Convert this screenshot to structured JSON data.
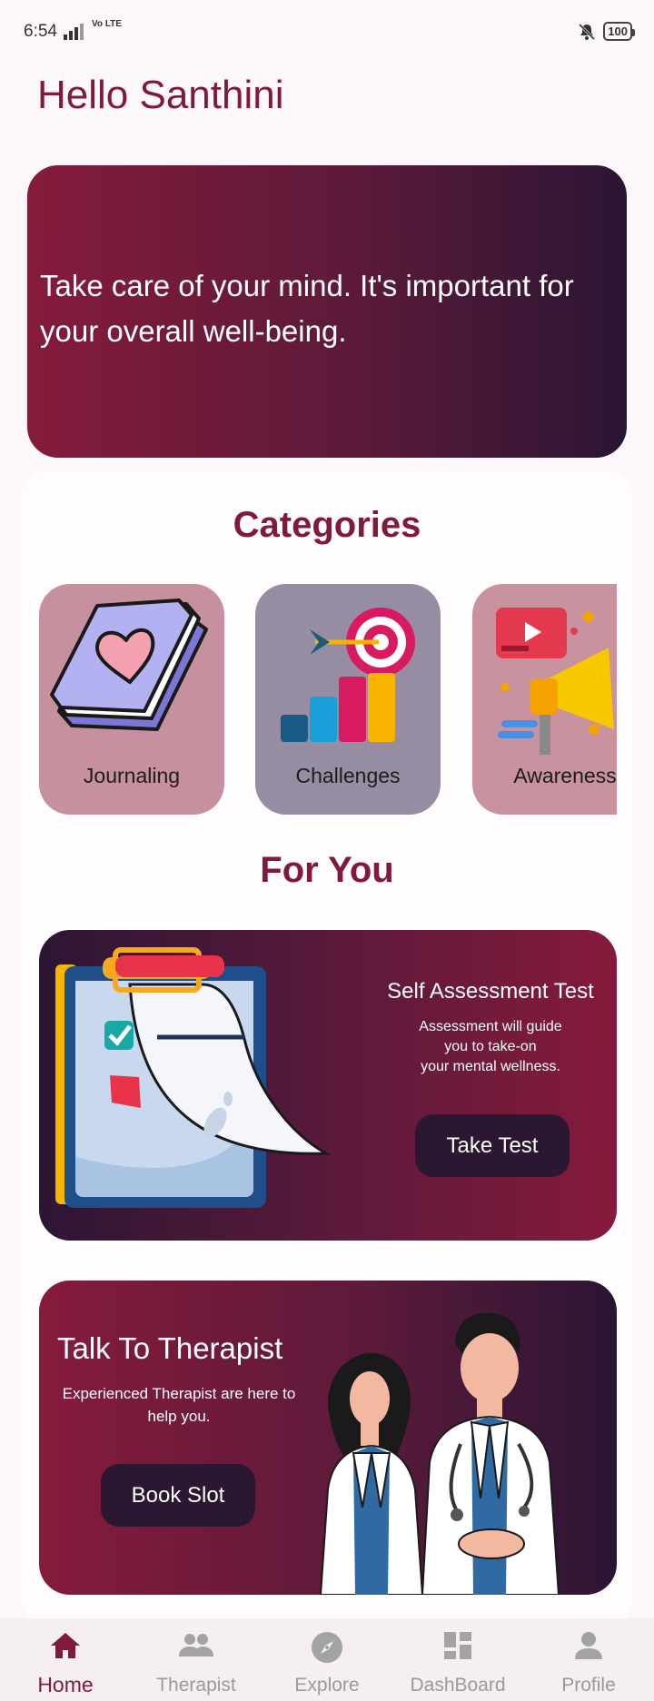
{
  "status_bar": {
    "time": "6:54",
    "network": "Vo LTE",
    "battery": "100"
  },
  "header": {
    "greeting": "Hello Santhini"
  },
  "hero": {
    "text": "Take care of your mind. It's important for your overall well-being."
  },
  "categories": {
    "title": "Categories",
    "items": [
      {
        "label": "Journaling",
        "icon": "journal-heart-icon"
      },
      {
        "label": "Challenges",
        "icon": "target-chart-icon"
      },
      {
        "label": "Awareness",
        "icon": "megaphone-icon"
      }
    ]
  },
  "for_you": {
    "title": "For You",
    "assessment": {
      "title": "Self Assessment Test",
      "desc_line1": "Assessment will guide",
      "desc_line2": "you to take-on",
      "desc_line3": "your mental wellness.",
      "button": "Take Test"
    },
    "therapist": {
      "title": "Talk To Therapist",
      "desc": "Experienced Therapist are here to help you.",
      "button": "Book Slot"
    }
  },
  "bottom_nav": {
    "items": [
      {
        "label": "Home",
        "icon": "home-icon",
        "active": true
      },
      {
        "label": "Therapist",
        "icon": "people-icon",
        "active": false
      },
      {
        "label": "Explore",
        "icon": "compass-icon",
        "active": false
      },
      {
        "label": "DashBoard",
        "icon": "dashboard-icon",
        "active": false
      },
      {
        "label": "Profile",
        "icon": "person-icon",
        "active": false
      }
    ]
  },
  "colors": {
    "brand": "#7f1a3e",
    "button_dark": "#2c1733",
    "gradient_dark": "#2b1533",
    "gradient_light": "#851b3b"
  }
}
